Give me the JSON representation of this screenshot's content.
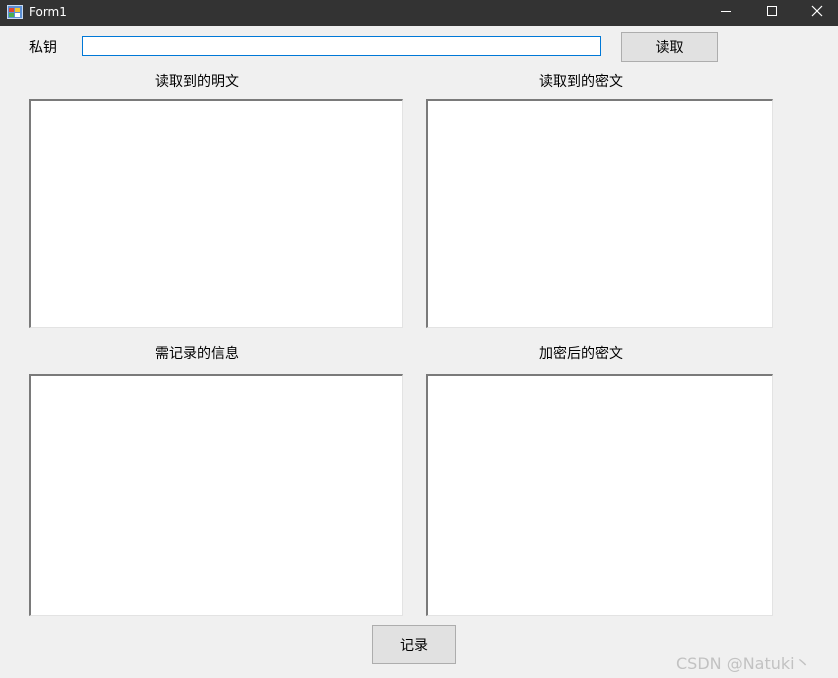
{
  "window": {
    "title": "Form1",
    "icon": "winforms-app-icon"
  },
  "form": {
    "key_label": "私钥",
    "key_value": "",
    "read_button": "读取",
    "plain_read_label": "读取到的明文",
    "cipher_read_label": "读取到的密文",
    "info_label": "需记录的信息",
    "encrypted_label": "加密后的密文",
    "record_button": "记录"
  },
  "textboxes": {
    "plain_read": "",
    "cipher_read": "",
    "info": "",
    "encrypted": ""
  },
  "watermark": "CSDN @Natuki丶",
  "colors": {
    "titlebar": "#333333",
    "background": "#f0f0f0",
    "focus_border": "#0078d7",
    "button_face": "#e1e1e1"
  }
}
